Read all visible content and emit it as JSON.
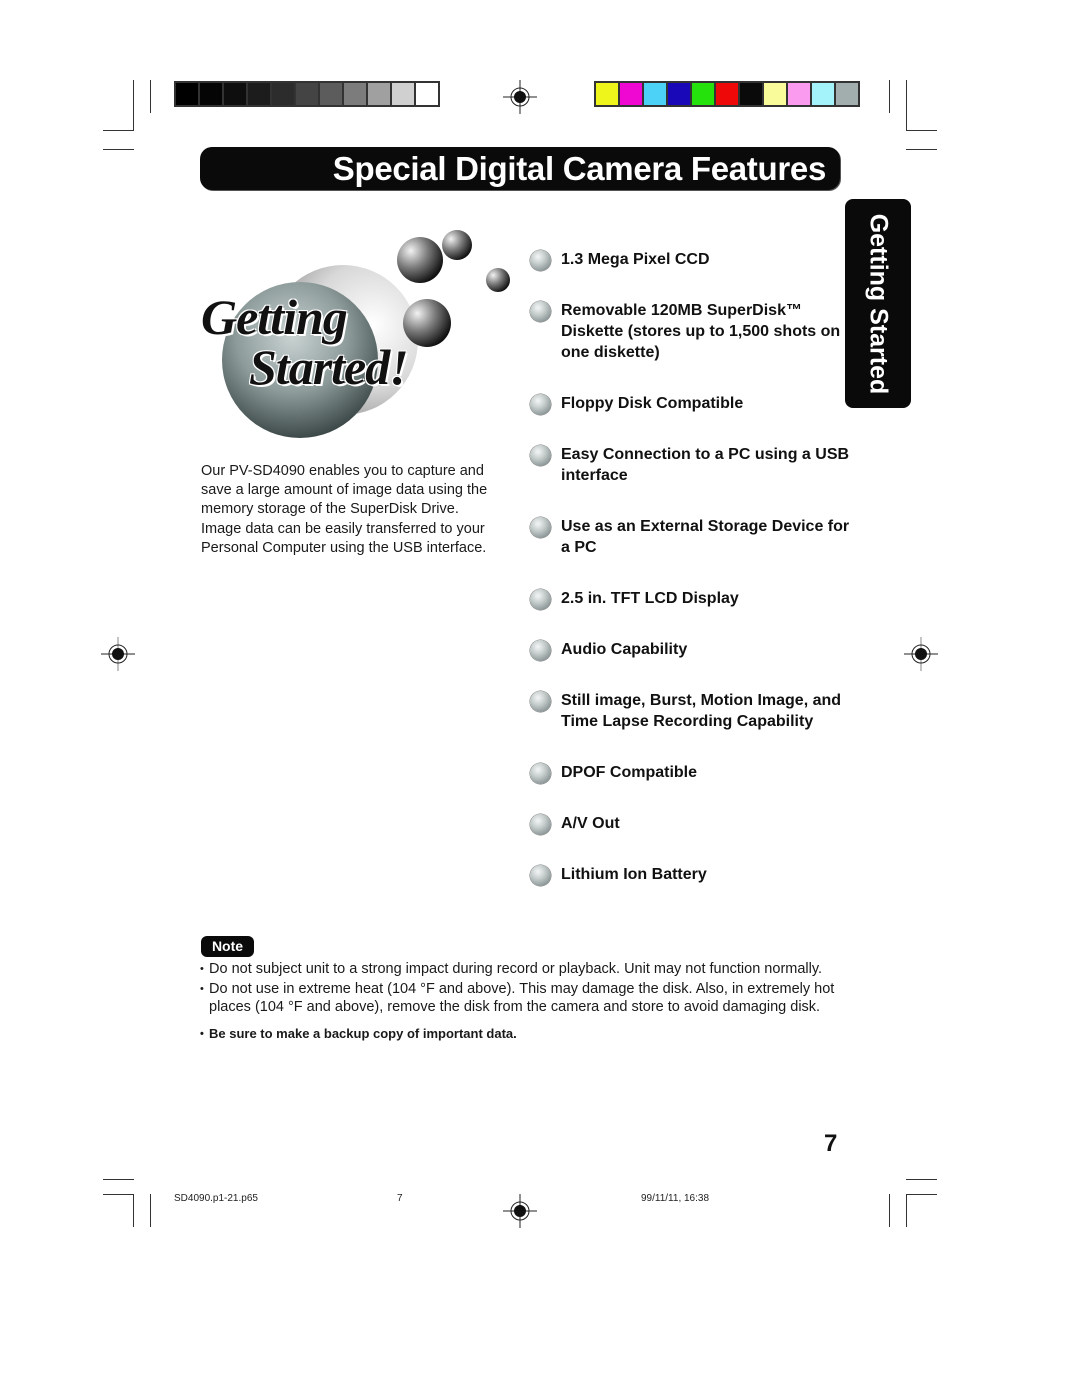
{
  "header": {
    "title": "Special Digital Camera Features",
    "side_tab": "Getting Started"
  },
  "print_marks": {
    "grayscale_swatches": [
      "#000000",
      "#050505",
      "#0e0e0e",
      "#1c1c1c",
      "#2c2c2c",
      "#444444",
      "#5c5c5c",
      "#7c7c7c",
      "#a0a0a0",
      "#d0d0d0",
      "#ffffff"
    ],
    "color_swatches": [
      "#eef51a",
      "#ef08d2",
      "#4dd2f7",
      "#1808b8",
      "#26e20c",
      "#ef0808",
      "#0a0a0a",
      "#f9fb9b",
      "#fb9bef",
      "#a4f3fb",
      "#a2aeae"
    ]
  },
  "logo": {
    "line1": "Getting",
    "line2": "Started!"
  },
  "intro": {
    "text": "Our PV-SD4090 enables you to capture and save a large amount of image data using the memory storage of the SuperDisk Drive. Image data can be easily transferred to your Personal Computer using the USB interface."
  },
  "features": [
    {
      "label": "1.3 Mega Pixel CCD"
    },
    {
      "label": "Removable 120MB SuperDisk™ Diskette (stores up to 1,500 shots on one diskette)"
    },
    {
      "label": "Floppy Disk Compatible"
    },
    {
      "label": "Easy Connection to a PC using a USB interface"
    },
    {
      "label": "Use as an External Storage Device for a PC"
    },
    {
      "label": "2.5 in.  TFT LCD Display"
    },
    {
      "label": "Audio Capability"
    },
    {
      "label": "Still image, Burst, Motion Image, and Time Lapse Recording Capability"
    },
    {
      "label": "DPOF Compatible"
    },
    {
      "label": "A/V Out"
    },
    {
      "label": "Lithium Ion Battery"
    }
  ],
  "note": {
    "badge": "Note",
    "items": [
      "Do not subject unit to a strong impact during record or playback. Unit may not function normally.",
      "Do not use in extreme heat (104 °F and above). This may damage the disk. Also, in extremely hot places (104 °F and above), remove the disk from the camera and store to avoid damaging disk.",
      "Be sure to make a backup copy of important data."
    ]
  },
  "page_number": "7",
  "footer": {
    "filename": "SD4090.p1-21.p65",
    "page": "7",
    "timestamp": "99/11/11, 16:38"
  }
}
